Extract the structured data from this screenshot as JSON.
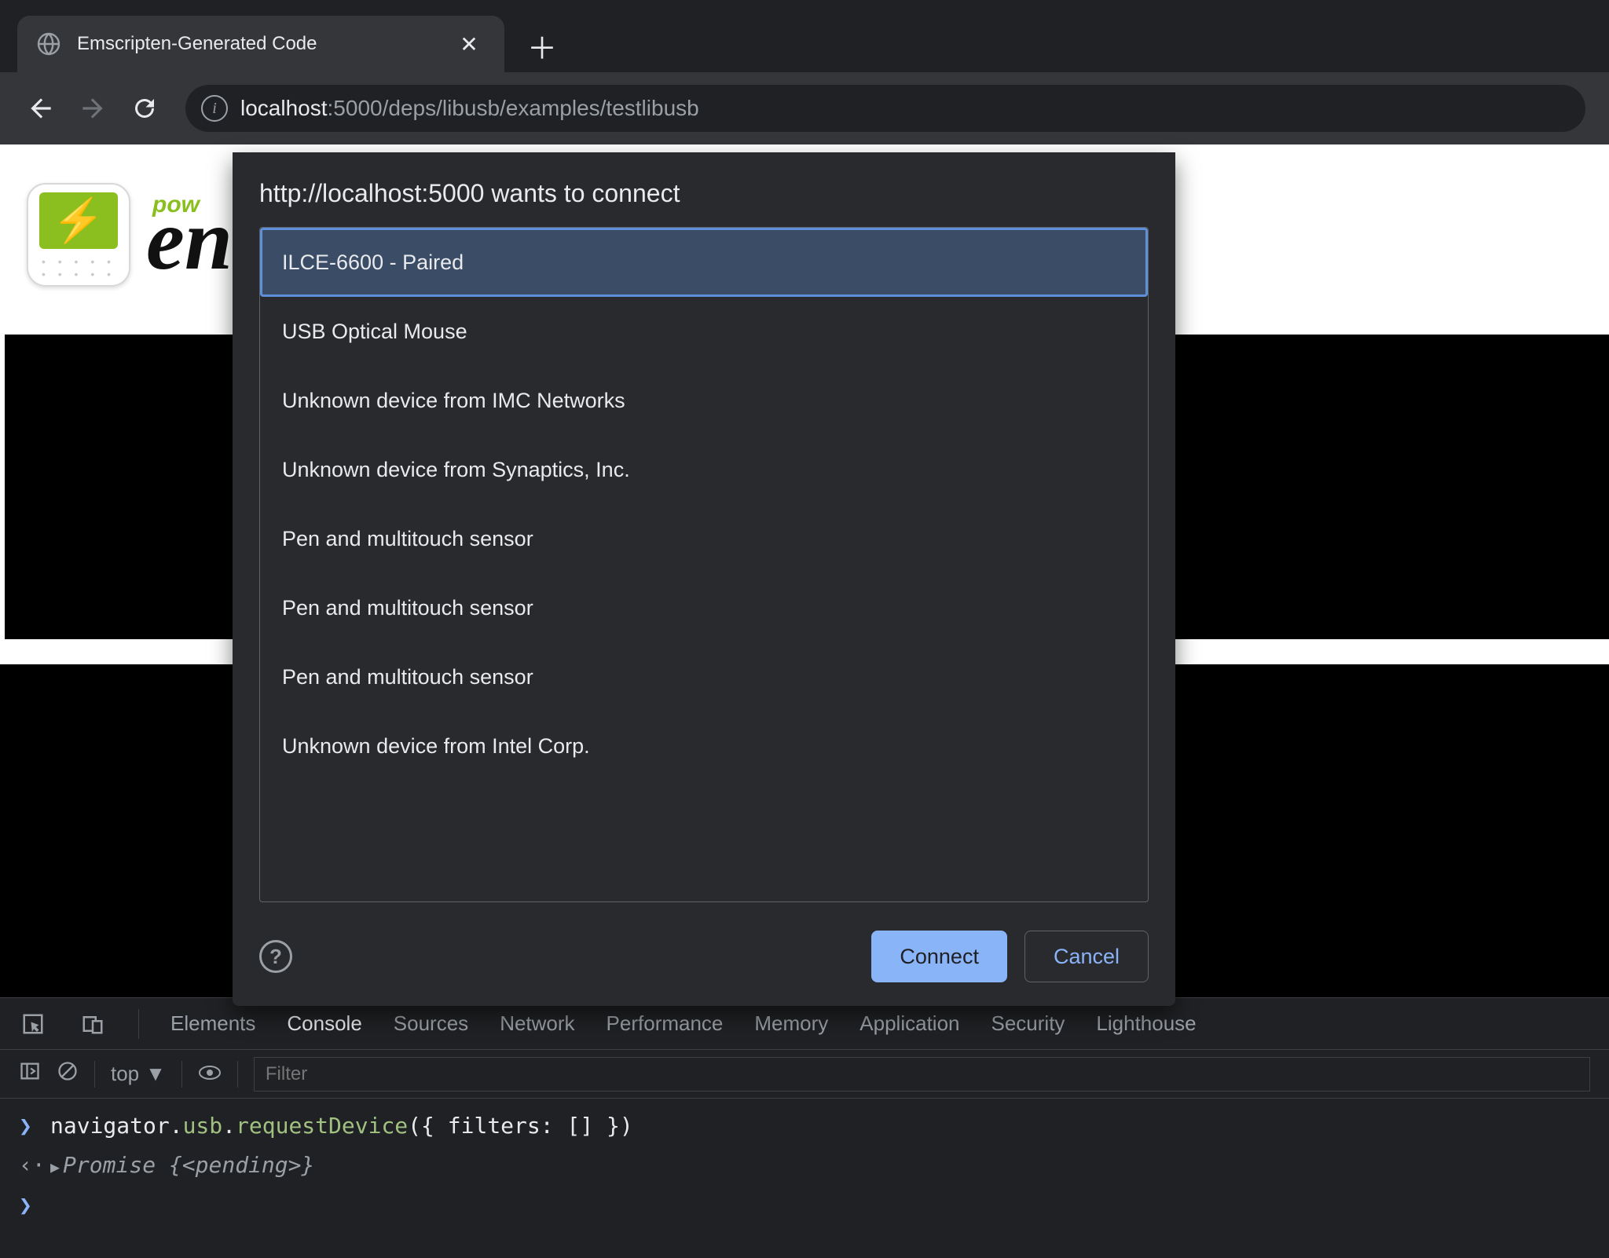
{
  "tab": {
    "title": "Emscripten-Generated Code"
  },
  "url": {
    "host": "localhost",
    "port": ":5000",
    "path": "/deps/libusb/examples/testlibusb"
  },
  "page": {
    "pow": "pow",
    "en": "en"
  },
  "dialog": {
    "title": "http://localhost:5000 wants to connect",
    "devices": [
      "ILCE-6600 - Paired",
      "USB Optical Mouse",
      "Unknown device from IMC Networks",
      "Unknown device from Synaptics, Inc.",
      "Pen and multitouch sensor",
      "Pen and multitouch sensor",
      "Pen and multitouch sensor",
      "Unknown device from Intel Corp."
    ],
    "connect": "Connect",
    "cancel": "Cancel",
    "help": "?"
  },
  "devtools": {
    "tabs": [
      "Elements",
      "Console",
      "Sources",
      "Network",
      "Performance",
      "Memory",
      "Application",
      "Security",
      "Lighthouse"
    ],
    "context": "top",
    "filter_placeholder": "Filter",
    "input_line": "navigator.usb.requestDevice({ filters: [] })",
    "output_prefix": "Promise",
    "output_inner": "{<pending>}"
  }
}
